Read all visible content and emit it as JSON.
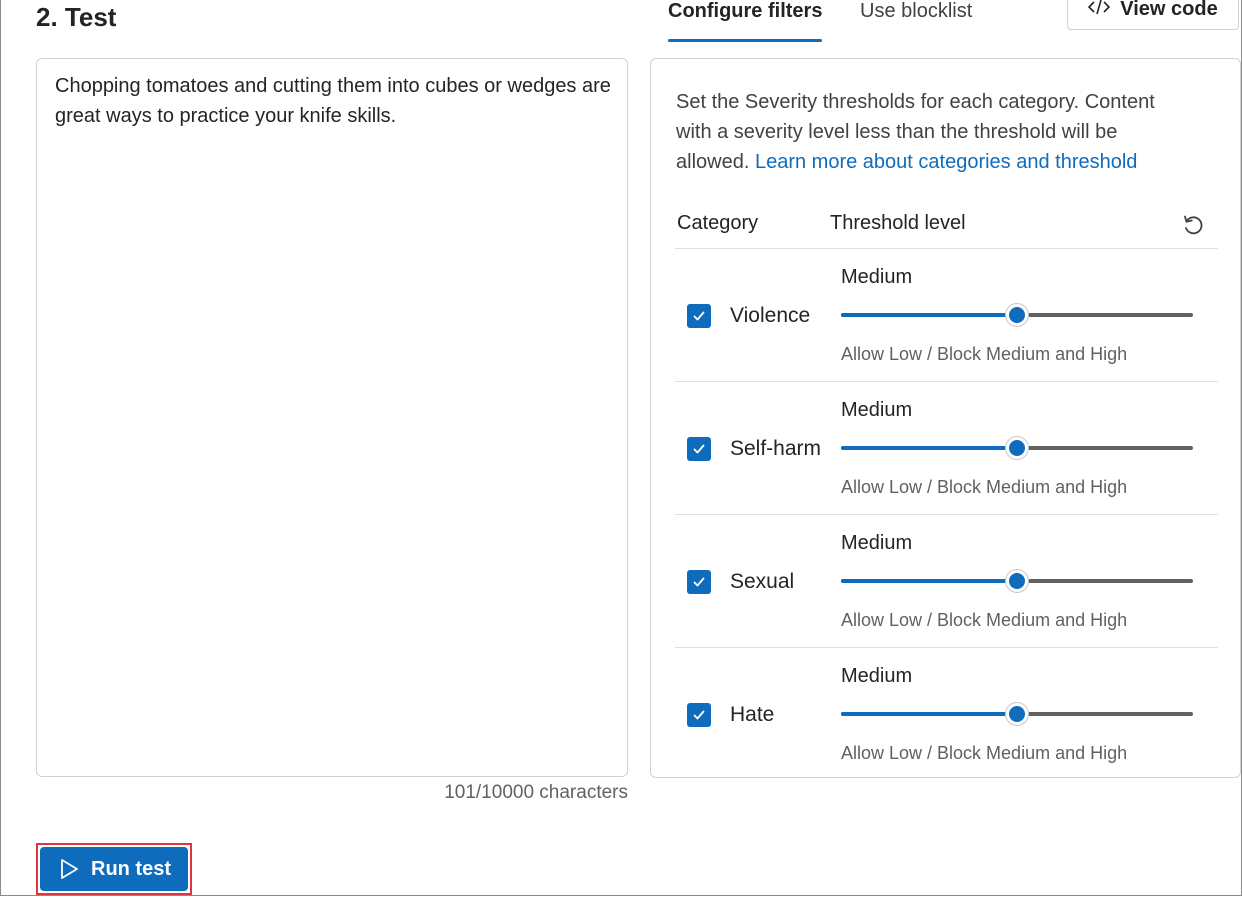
{
  "section_title": "2. Test",
  "tabs": [
    {
      "label": "Configure filters",
      "active": true
    },
    {
      "label": "Use blocklist",
      "active": false
    }
  ],
  "view_code_label": "View code",
  "input_text": "Chopping tomatoes and cutting them into cubes or wedges are great ways to practice your knife skills.",
  "char_count": "101/10000 characters",
  "filters": {
    "description": "Set the Severity thresholds for each category. Content with a severity level less than the threshold will be allowed.",
    "learn_more_link": "Learn more about categories and threshold",
    "header_category": "Category",
    "header_threshold": "Threshold level",
    "categories": [
      {
        "name": "Violence",
        "checked": true,
        "level": "Medium",
        "value_fraction": 0.5,
        "note": "Allow Low / Block Medium and High"
      },
      {
        "name": "Self-harm",
        "checked": true,
        "level": "Medium",
        "value_fraction": 0.5,
        "note": "Allow Low / Block Medium and High"
      },
      {
        "name": "Sexual",
        "checked": true,
        "level": "Medium",
        "value_fraction": 0.5,
        "note": "Allow Low / Block Medium and High"
      },
      {
        "name": "Hate",
        "checked": true,
        "level": "Medium",
        "value_fraction": 0.5,
        "note": "Allow Low / Block Medium and High"
      }
    ]
  },
  "run_button_label": "Run test",
  "colors": {
    "accent": "#0f6cbd",
    "highlight_border": "#e0343f"
  },
  "icons": [
    "code-icon",
    "reset-icon",
    "checkmark-icon",
    "play-icon"
  ]
}
